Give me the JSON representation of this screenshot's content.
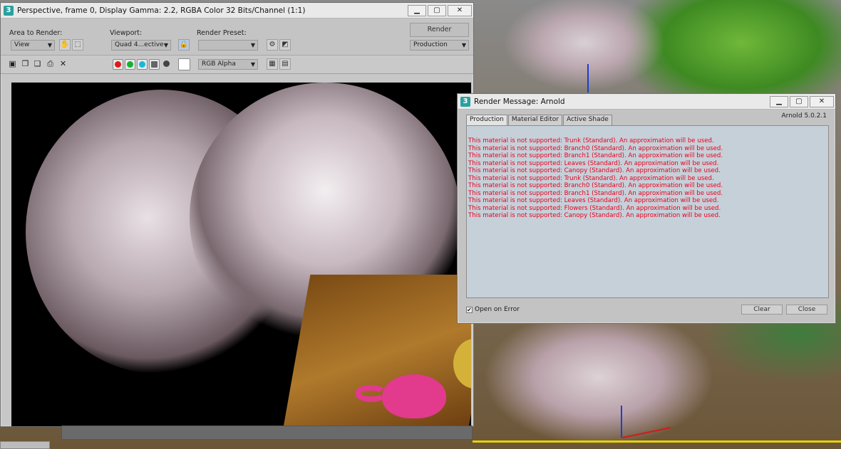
{
  "render_window": {
    "title": "Perspective, frame 0, Display Gamma: 2.2, RGBA Color 32 Bits/Channel (1:1)",
    "controls": {
      "minimize": "▁",
      "maximize": "▢",
      "close": "✕"
    },
    "area_to_render": {
      "label": "Area to Render:",
      "value": "View"
    },
    "viewport": {
      "label": "Viewport:",
      "value": "Quad 4...ective"
    },
    "render_preset": {
      "label": "Render Preset:",
      "value": ""
    },
    "render_button": "Render",
    "production_dropdown": "Production",
    "channel_dropdown": "RGB Alpha"
  },
  "message_window": {
    "title": "Render Message: Arnold",
    "controls": {
      "minimize": "▁",
      "maximize": "▢",
      "close": "✕"
    },
    "tabs": [
      {
        "label": "Production",
        "active": true
      },
      {
        "label": "Material Editor",
        "active": false
      },
      {
        "label": "Active Shade",
        "active": false
      }
    ],
    "version": "Arnold 5.0.2.1",
    "messages": [
      "This material is not supported: Trunk (Standard). An approximation will be used.",
      "This material is not supported: Branch0 (Standard). An approximation will be used.",
      "This material is not supported: Branch1 (Standard). An approximation will be used.",
      "This material is not supported: Leaves (Standard). An approximation will be used.",
      "This material is not supported: Canopy (Standard). An approximation will be used.",
      "This material is not supported: Trunk (Standard). An approximation will be used.",
      "This material is not supported: Branch0 (Standard). An approximation will be used.",
      "This material is not supported: Branch1 (Standard). An approximation will be used.",
      "This material is not supported: Leaves (Standard). An approximation will be used.",
      "This material is not supported: Flowers (Standard). An approximation will be used.",
      "This material is not supported: Canopy (Standard). An approximation will be used."
    ],
    "open_on_error": {
      "label": "Open on Error",
      "checked": true
    },
    "clear_button": "Clear",
    "close_button": "Close",
    "message_color": "#e8001c"
  },
  "app_icon": "3",
  "footer_left": "",
  "colors": {
    "channel_red": "#e01818",
    "channel_green": "#18b030",
    "channel_blue": "#18b8d8"
  }
}
